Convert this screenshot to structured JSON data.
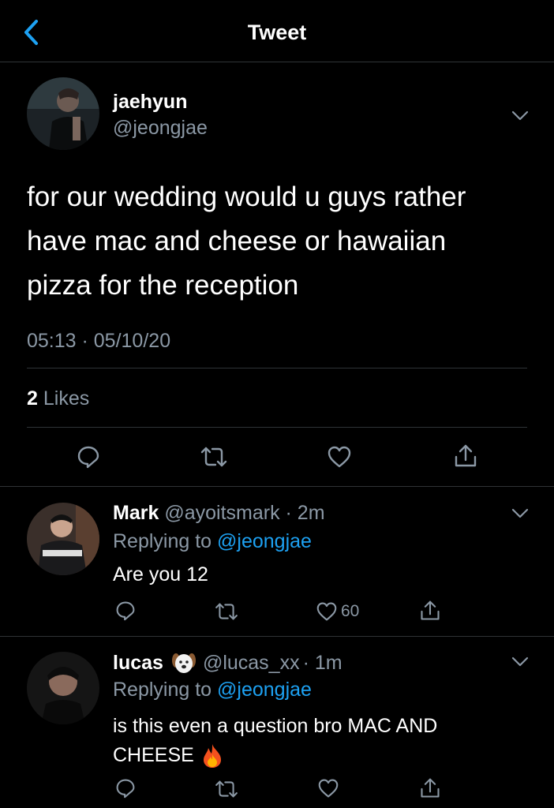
{
  "header": {
    "title": "Tweet"
  },
  "main_tweet": {
    "display_name": "jaehyun",
    "handle": "@jeongjae",
    "text_lines": [
      "for our wedding would u guys rather",
      "have mac and cheese or hawaiian",
      "pizza for the reception"
    ],
    "timestamp": "05:13 · 05/10/20",
    "likes_count": "2",
    "likes_label": "Likes"
  },
  "replies": [
    {
      "display_name": "Mark",
      "handle": "@ayoitsmark",
      "time": "· 2m",
      "replying_prefix": "Replying to",
      "replying_handle": "@jeongjae",
      "text": "Are you 12",
      "like_count": "60"
    },
    {
      "display_name": "lucas",
      "name_emoji": "dog-face-emoji",
      "handle": "@lucas_xx",
      "time": "· 1m",
      "replying_prefix": "Replying to",
      "replying_handle": "@jeongjae",
      "text_line1": "is this even a question bro MAC AND",
      "text_line2": "CHEESE",
      "text_emoji": "fire-emoji"
    }
  ],
  "colors": {
    "background": "#000000",
    "accent": "#1da1f2",
    "muted": "#8b98a5",
    "divider": "#2f3336",
    "icon": "#8b98a5"
  }
}
